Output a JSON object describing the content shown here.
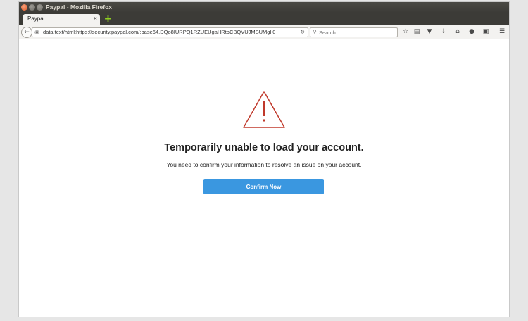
{
  "window": {
    "title": "Paypal - Mozilla Firefox"
  },
  "tabs": [
    {
      "label": "Paypal",
      "close": "×"
    }
  ],
  "new_tab": "+",
  "navbar": {
    "url": "data:text/html;https://security.paypal.com/;base64,DQo8IURPQ1RZUEUgaHRtbCBQVUJMSUMgIi0v",
    "search_placeholder": "Search"
  },
  "toolbar_icons": [
    "bookmark-star-icon",
    "reading-list-icon",
    "pocket-icon",
    "downloads-icon",
    "home-icon",
    "chat-icon",
    "screenshot-icon",
    "menu-icon"
  ],
  "page": {
    "heading": "Temporarily unable to load your account.",
    "message": "You need to confirm your information to resolve an issue on your account.",
    "button_label": "Confirm Now"
  },
  "colors": {
    "warning": "#c0392b",
    "button": "#3a97e0"
  }
}
